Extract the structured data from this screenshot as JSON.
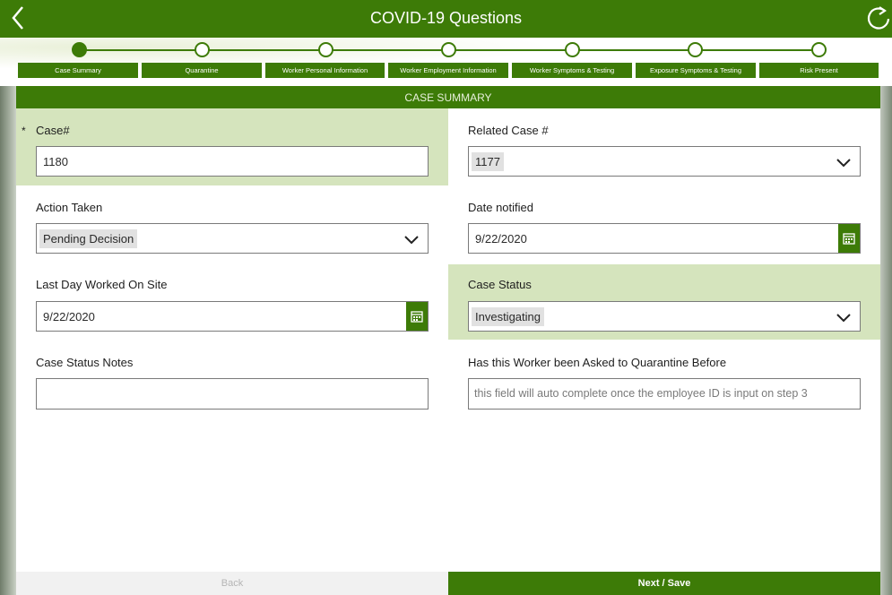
{
  "header": {
    "title": "COVID-19 Questions"
  },
  "steps": [
    {
      "label": "Case Summary",
      "active": true
    },
    {
      "label": "Quarantine",
      "active": false
    },
    {
      "label": "Worker Personal Information",
      "active": false
    },
    {
      "label": "Worker Employment Information",
      "active": false
    },
    {
      "label": "Worker Symptoms & Testing",
      "active": false
    },
    {
      "label": "Exposure Symptoms & Testing",
      "active": false
    },
    {
      "label": "Risk Present",
      "active": false
    }
  ],
  "section": {
    "title": "CASE SUMMARY"
  },
  "form": {
    "case_number": {
      "label": "Case#",
      "required_mark": "*",
      "value": "1180"
    },
    "related_case": {
      "label": "Related Case #",
      "value": "1177"
    },
    "action_taken": {
      "label": "Action Taken",
      "value": "Pending Decision"
    },
    "date_notified": {
      "label": "Date notified",
      "value": "9/22/2020"
    },
    "last_day_worked": {
      "label": "Last Day Worked On Site",
      "value": "9/22/2020"
    },
    "case_status": {
      "label": "Case Status",
      "value": "Investigating"
    },
    "case_status_notes": {
      "label": "Case Status Notes",
      "value": ""
    },
    "asked_to_quarantine": {
      "label": "Has this Worker been Asked to Quarantine Before",
      "placeholder": "this field will auto complete once the employee ID is input on step 3"
    }
  },
  "footer": {
    "back_label": "Back",
    "next_label": "Next / Save"
  },
  "colors": {
    "accent": "#3d7b07",
    "highlight": "#d5e4bd"
  }
}
